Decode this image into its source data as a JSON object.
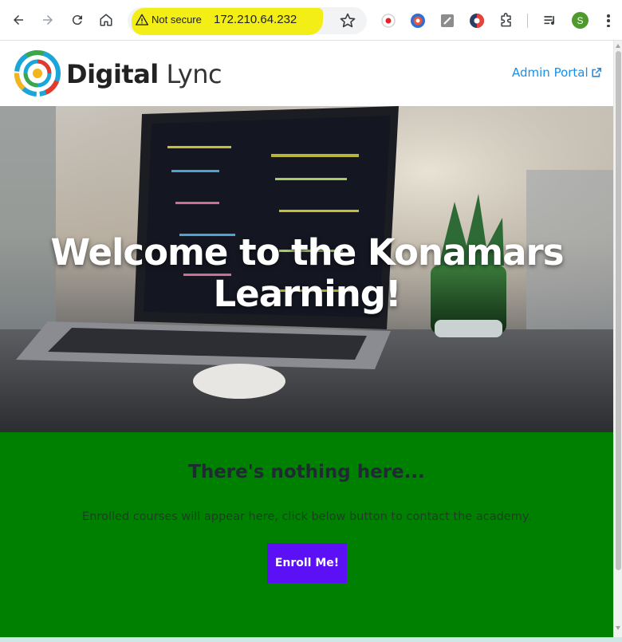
{
  "browser": {
    "security_label": "Not secure",
    "url": "172.210.64.232",
    "profile_initial": "S",
    "icons": [
      "back-icon",
      "forward-icon",
      "reload-icon",
      "home-icon",
      "warning-icon",
      "bookmark-star-icon",
      "record-extension-icon",
      "shield-extension-icon",
      "edit-extension-icon",
      "screenshot-extension-icon",
      "extensions-puzzle-icon",
      "media-queue-icon",
      "more-menu-icon"
    ]
  },
  "header": {
    "logo_bold": "Digital",
    "logo_light": "Lync",
    "admin_link": "Admin Portal",
    "admin_link_color": "#1a8ee8"
  },
  "hero": {
    "title": "Welcome to the Konamars Learning!"
  },
  "enroll": {
    "heading": "There's nothing here...",
    "subtext": "Enrolled courses will appear here, click below button to contact the academy.",
    "button_label": "Enroll Me!",
    "background_color": "#008000",
    "button_color": "#5b10f6"
  }
}
